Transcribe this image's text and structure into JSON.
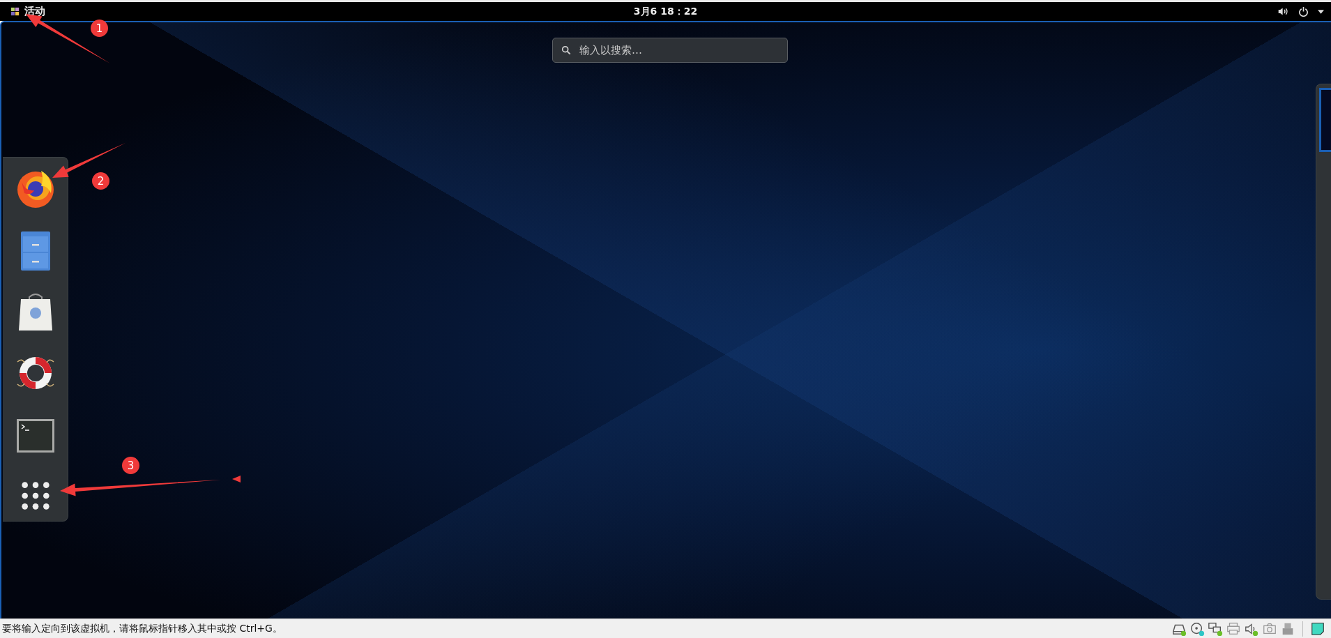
{
  "top_bar": {
    "activities": "活动",
    "clock": "3月6 18：22"
  },
  "search": {
    "placeholder": "输入以搜索…"
  },
  "dock": {
    "items": [
      {
        "kind": "browser"
      },
      {
        "kind": "files"
      },
      {
        "kind": "software"
      },
      {
        "kind": "help"
      },
      {
        "kind": "terminal"
      },
      {
        "kind": "app-grid"
      }
    ]
  },
  "annotations": [
    {
      "label": "1"
    },
    {
      "label": "2"
    },
    {
      "label": "3"
    }
  ],
  "status_bar": {
    "message": "要将输入定向到该虚拟机，请将鼠标指针移入其中或按 Ctrl+G。",
    "devices": [
      {
        "kind": "disk",
        "color": "#6cbf2a"
      },
      {
        "kind": "optical",
        "color": "#2cc6c6"
      },
      {
        "kind": "network",
        "color": "#6cbf2a"
      },
      {
        "kind": "printer"
      },
      {
        "kind": "sound",
        "color": "#6cbf2a"
      },
      {
        "kind": "camera"
      },
      {
        "kind": "usb"
      }
    ]
  }
}
